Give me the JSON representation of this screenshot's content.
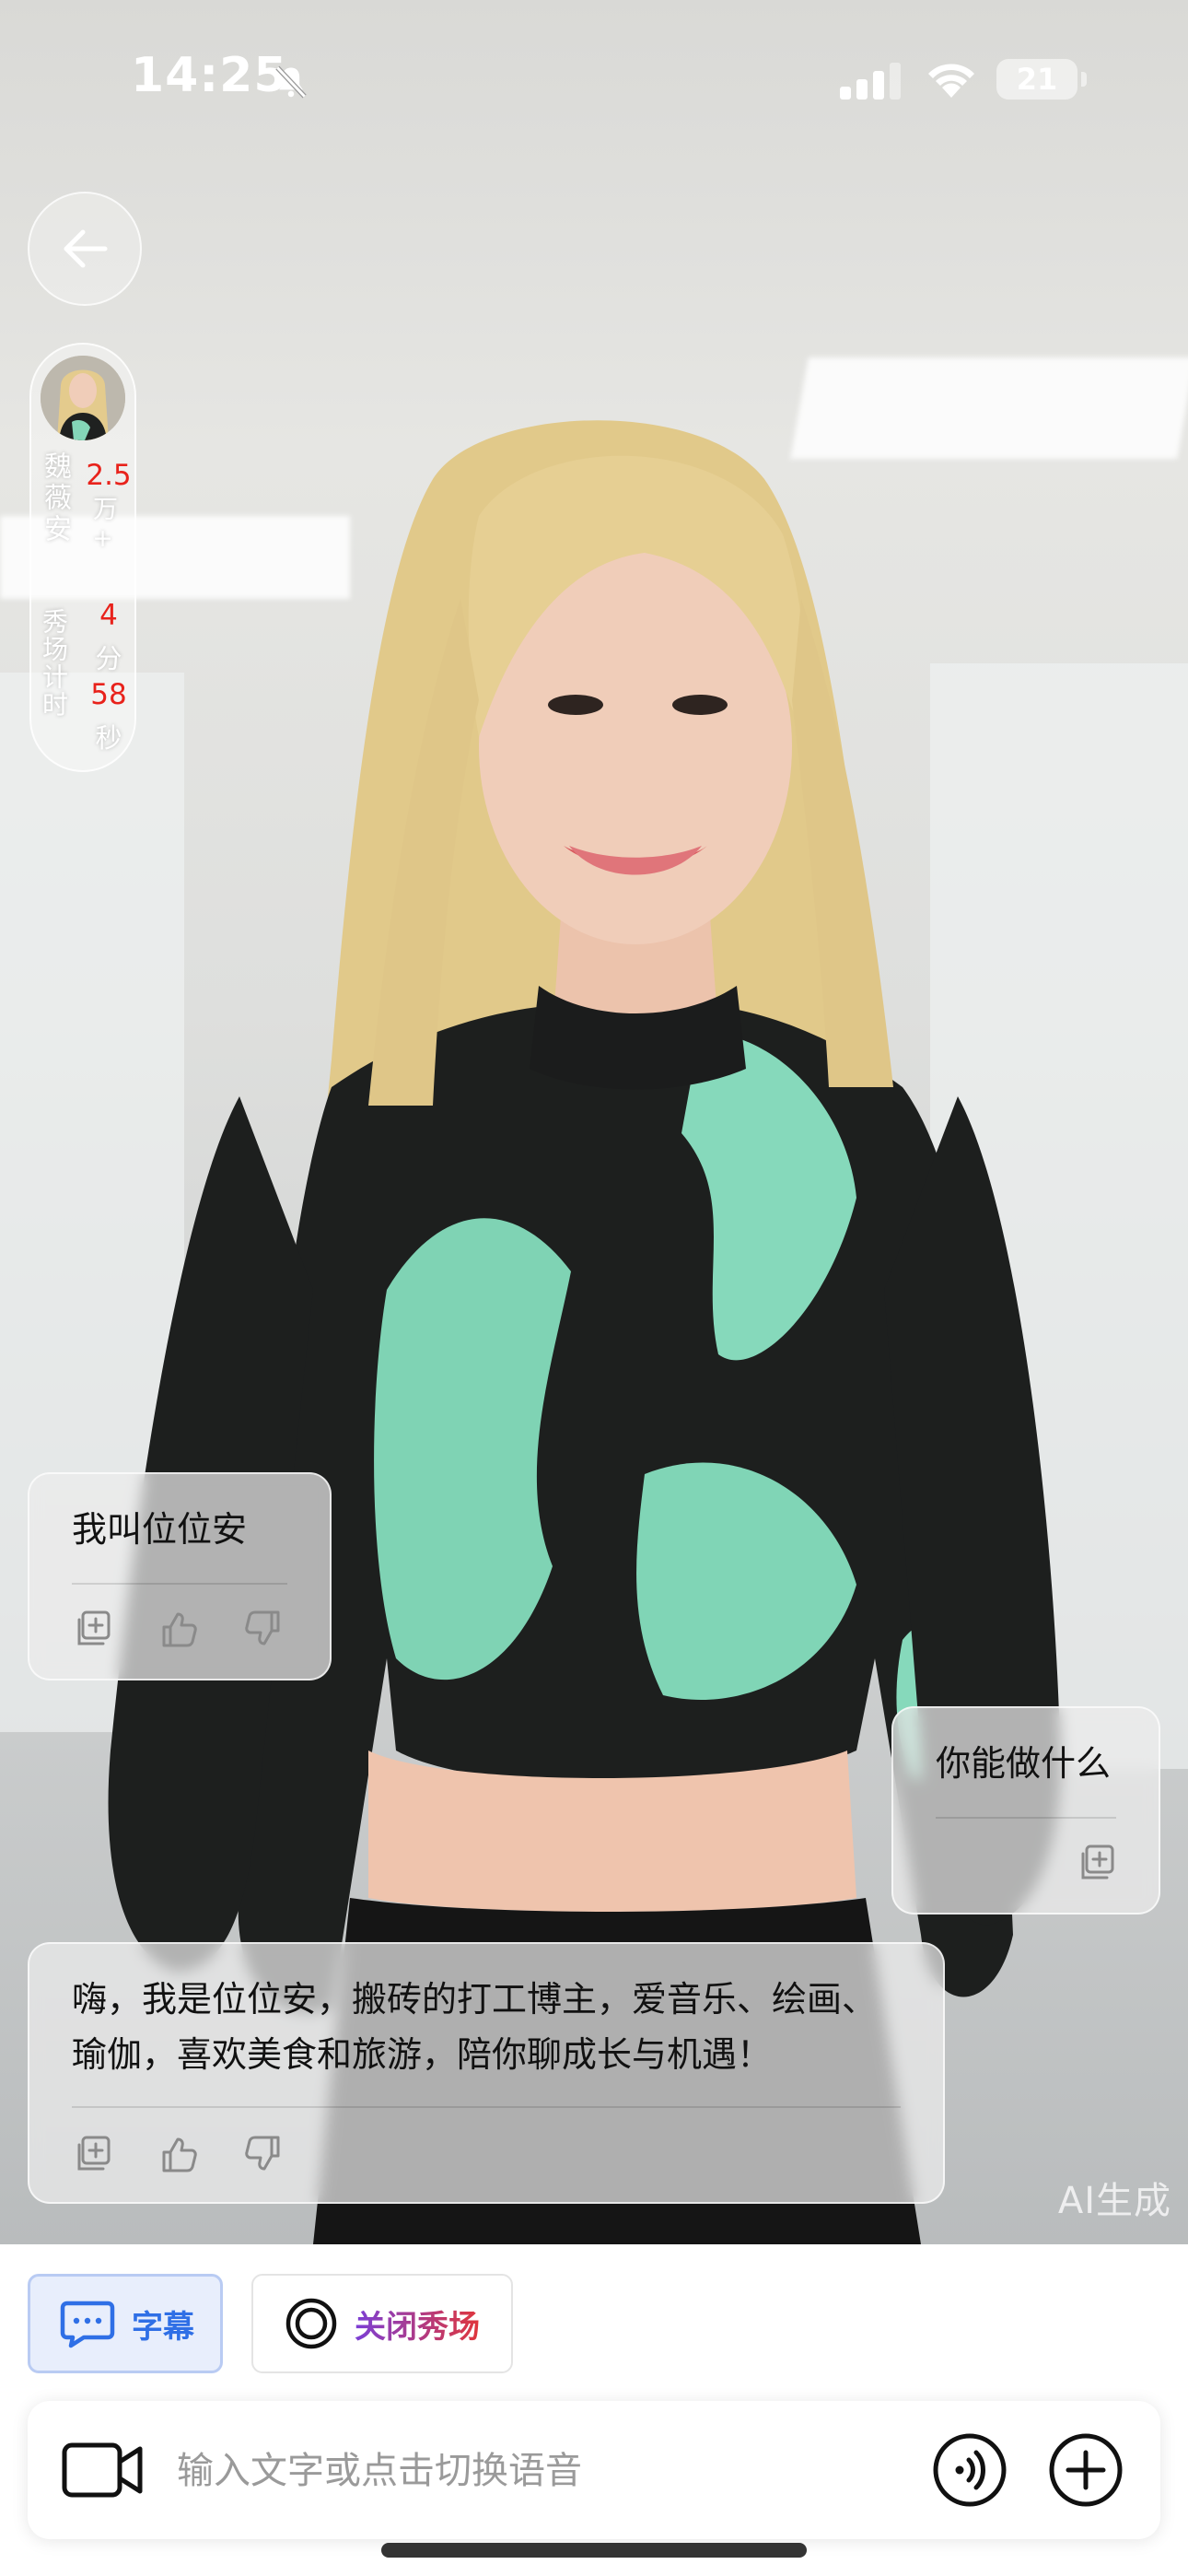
{
  "status_bar": {
    "time": "14:25",
    "battery": "21"
  },
  "host": {
    "name_chars": "魏薇安",
    "followers_value": "2.5",
    "followers_unit": "万+",
    "timer_label": "秀场计时",
    "timer_minutes": "4",
    "timer_minutes_unit": "分",
    "timer_seconds": "58",
    "timer_seconds_unit": "秒"
  },
  "messages": [
    {
      "role": "ai",
      "text": "我叫位位安"
    },
    {
      "role": "user",
      "text": "你能做什么"
    },
    {
      "role": "ai",
      "text": "嗨，我是位位安，搬砖的打工博主，爱音乐、绘画、瑜伽，喜欢美食和旅游，陪你聊成长与机遇！"
    }
  ],
  "watermark": "AI生成",
  "toolbar": {
    "subtitle_label": "字幕",
    "close_show_label": "关闭秀场",
    "input_placeholder": "输入文字或点击切换语音"
  },
  "colors": {
    "accent_blue": "#2f6fe6",
    "close_show_gradient_start": "#7b3fd6",
    "close_show_gradient_end": "#e0363b",
    "host_red": "#e8221b"
  },
  "icons": {
    "back": "arrow-left-icon",
    "mute": "bell-slash-icon",
    "subtitle": "chat-bubble-icon",
    "close_show": "ring-icon",
    "camera": "video-camera-icon",
    "voice": "voice-wave-icon",
    "plus": "plus-circle-icon"
  }
}
